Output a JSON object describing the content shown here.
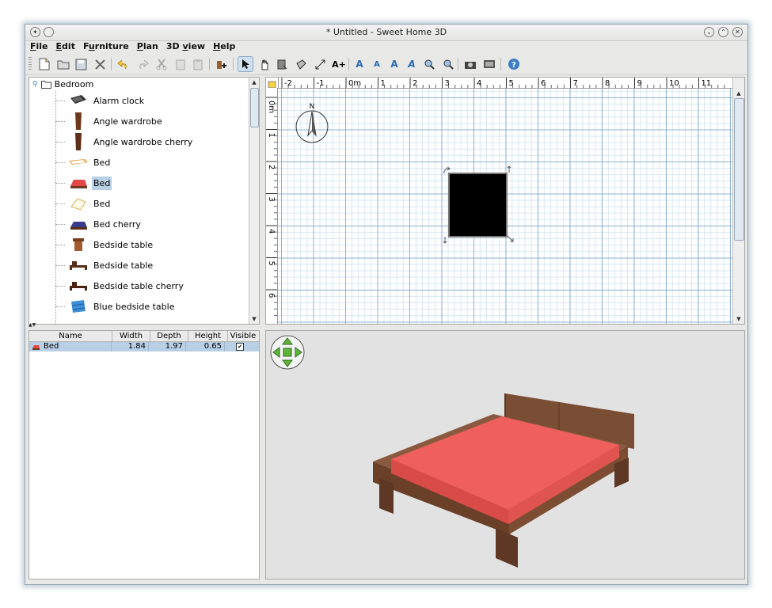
{
  "window": {
    "title": "* Untitled - Sweet Home 3D"
  },
  "menu": [
    {
      "mnemonic": "F",
      "rest": "ile"
    },
    {
      "mnemonic": "E",
      "rest": "dit"
    },
    {
      "pre": "F",
      "mnemonic": "u",
      "rest": "rniture"
    },
    {
      "mnemonic": "P",
      "rest": "lan"
    },
    {
      "pre": "3D ",
      "mnemonic": "v",
      "rest": "iew"
    },
    {
      "mnemonic": "H",
      "rest": "elp"
    }
  ],
  "menu_labels": {
    "file": "File",
    "edit": "Edit",
    "furniture": "Furniture",
    "plan": "Plan",
    "view3d": "3D view",
    "help": "Help"
  },
  "toolbar": {
    "icons": [
      "new-home-icon",
      "open-icon",
      "save-icon",
      "preferences-icon",
      "undo-icon",
      "redo-icon",
      "cut-icon",
      "copy-icon",
      "paste-icon",
      "add-furniture-icon",
      "select-mode-icon",
      "pan-mode-icon",
      "create-walls-icon",
      "create-rooms-icon",
      "create-dimensions-icon",
      "add-text-icon",
      "increase-text-size-icon",
      "decrease-text-size-icon",
      "bold-text-icon",
      "italic-text-icon",
      "zoom-in-icon",
      "zoom-out-icon",
      "create-photo-icon",
      "create-video-icon",
      "help-icon"
    ],
    "selected": "select-mode-icon"
  },
  "catalog": {
    "category": "Bedroom",
    "items": [
      {
        "label": "Alarm clock",
        "icon": "alarm-clock-icon"
      },
      {
        "label": "Angle wardrobe",
        "icon": "wardrobe-icon"
      },
      {
        "label": "Angle wardrobe cherry",
        "icon": "wardrobe-cherry-icon"
      },
      {
        "label": "Bed",
        "icon": "wooden-bed-icon"
      },
      {
        "label": "Bed",
        "icon": "red-bed-icon",
        "selected": true
      },
      {
        "label": "Bed",
        "icon": "bed-outline-icon"
      },
      {
        "label": "Bed cherry",
        "icon": "bed-cherry-icon"
      },
      {
        "label": "Bedside table",
        "icon": "bedside-table-icon"
      },
      {
        "label": "Bedside table",
        "icon": "bedside-table-low-icon"
      },
      {
        "label": "Bedside table cherry",
        "icon": "bedside-table-cherry-icon"
      },
      {
        "label": "Blue bedside table",
        "icon": "blue-bedside-table-icon"
      }
    ]
  },
  "furniture_table": {
    "columns": [
      "Name",
      "Width",
      "Depth",
      "Height",
      "Visible"
    ],
    "rows": [
      {
        "name": "Bed",
        "width": "1.84",
        "depth": "1.97",
        "height": "0.65",
        "visible": true
      }
    ]
  },
  "plan": {
    "x_ticks": [
      "-2",
      "-1",
      "0m",
      "1",
      "2",
      "3",
      "4",
      "5",
      "6",
      "7",
      "8",
      "9",
      "10",
      "11"
    ],
    "y_ticks": [
      "0m",
      "1",
      "2",
      "3",
      "4",
      "5",
      "6"
    ],
    "compass_label": "N"
  },
  "colors": {
    "accent": "#b8cfe5",
    "bed_cover": "#ef5f5b",
    "bed_wood": "#8a5a40",
    "grid_major": "#8fb4d6",
    "grid_minor": "#d7e6f3"
  }
}
